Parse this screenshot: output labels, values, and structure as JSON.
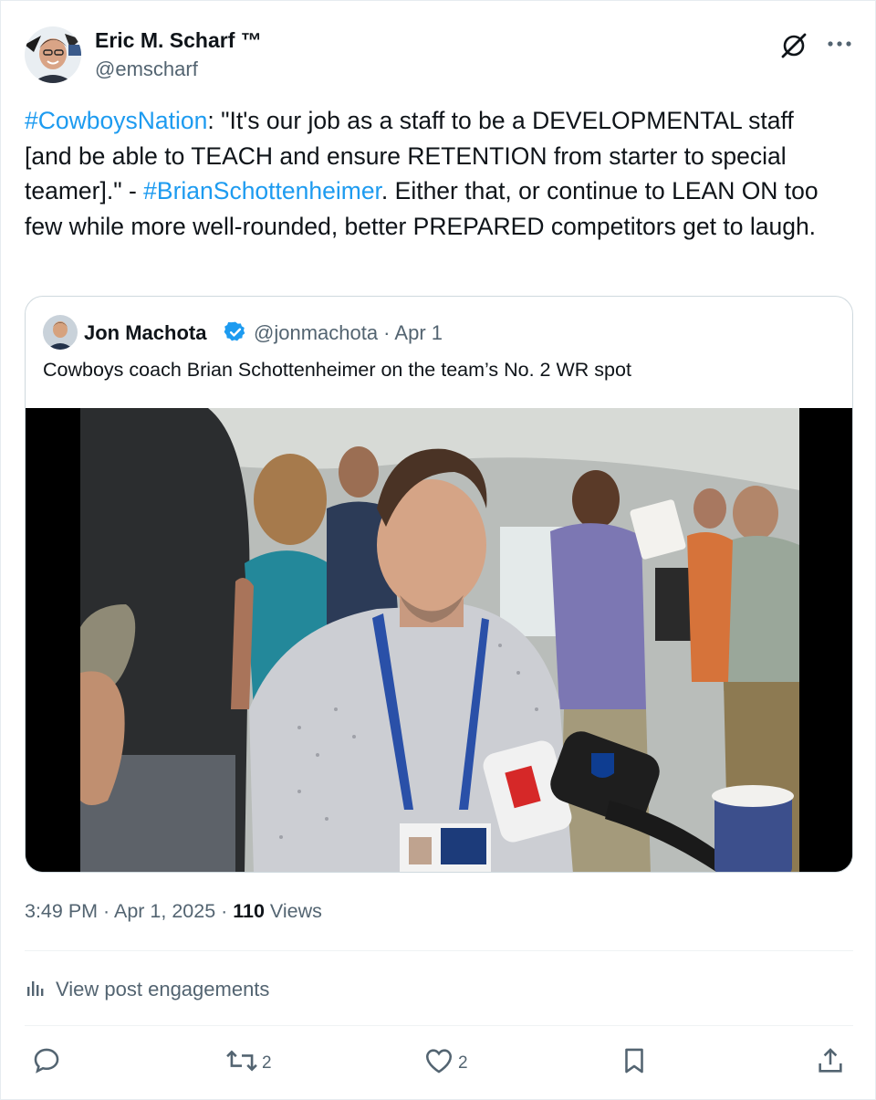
{
  "author": {
    "name": "Eric M. Scharf ™",
    "handle": "@emscharf"
  },
  "icons": {
    "grok": "grok-icon",
    "more": "more-options-icon",
    "verified": "verified-badge-icon",
    "reply": "reply-icon",
    "repost": "repost-icon",
    "like": "like-icon",
    "bookmark": "bookmark-icon",
    "share": "share-icon",
    "analytics": "analytics-icon"
  },
  "post": {
    "hashtag1": "#CowboysNation",
    "text1": ": \"It's our job as a staff to be a DEVELOPMENTAL staff [and be able to TEACH and ensure RETENTION from starter to special teamer].\" - ",
    "hashtag2": "#BrianSchottenheimer",
    "text2": ". Either that, or continue to LEAN ON too few while more well-rounded, better PREPARED competitors get to laugh."
  },
  "quote": {
    "name": "Jon Machota",
    "handle_date": "@jonmachota · Apr 1",
    "text": "Cowboys coach Brian Schottenheimer on the team’s No. 2 WR spot"
  },
  "meta": {
    "time_date": "3:49 PM · Apr 1, 2025 · ",
    "views_count": "110",
    "views_label": " Views"
  },
  "engagements_label": "View post engagements",
  "actions": {
    "reposts": "2",
    "likes": "2"
  },
  "colors": {
    "link": "#1d9bf0",
    "secondary": "#536471",
    "primary": "#0f1419",
    "border": "#cfd9de"
  }
}
